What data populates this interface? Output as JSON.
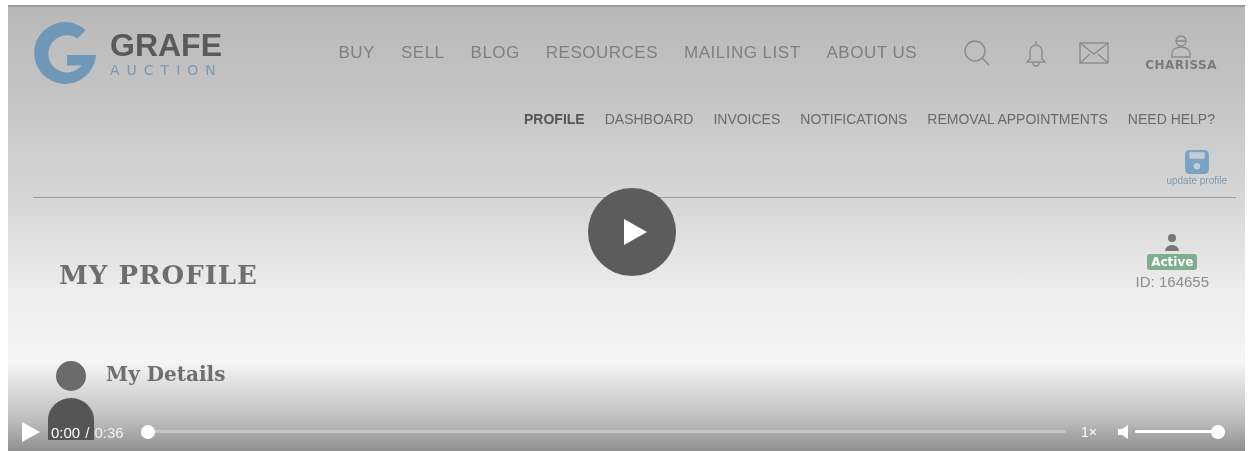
{
  "logo": {
    "title": "GRAFE",
    "subtitle": "AUCTION"
  },
  "nav": [
    "BUY",
    "SELL",
    "BLOG",
    "RESOURCES",
    "MAILING LIST",
    "ABOUT US"
  ],
  "user": {
    "name": "CHARISSA"
  },
  "subnav": [
    {
      "label": "PROFILE",
      "selected": true
    },
    {
      "label": "DASHBOARD",
      "selected": false
    },
    {
      "label": "INVOICES",
      "selected": false
    },
    {
      "label": "NOTIFICATIONS",
      "selected": false
    },
    {
      "label": "REMOVAL APPOINTMENTS",
      "selected": false
    },
    {
      "label": "NEED HELP?",
      "selected": false
    }
  ],
  "update_button": {
    "label": "update profile"
  },
  "page_title": "MY PROFILE",
  "account": {
    "status": "Active",
    "id": "ID: 164655"
  },
  "section_title": "My Details",
  "player": {
    "current": "0:00",
    "separator": "/",
    "duration": "0:36",
    "progress": {
      "level": 0
    },
    "speed": "1×",
    "volume": {
      "level": 1
    }
  }
}
